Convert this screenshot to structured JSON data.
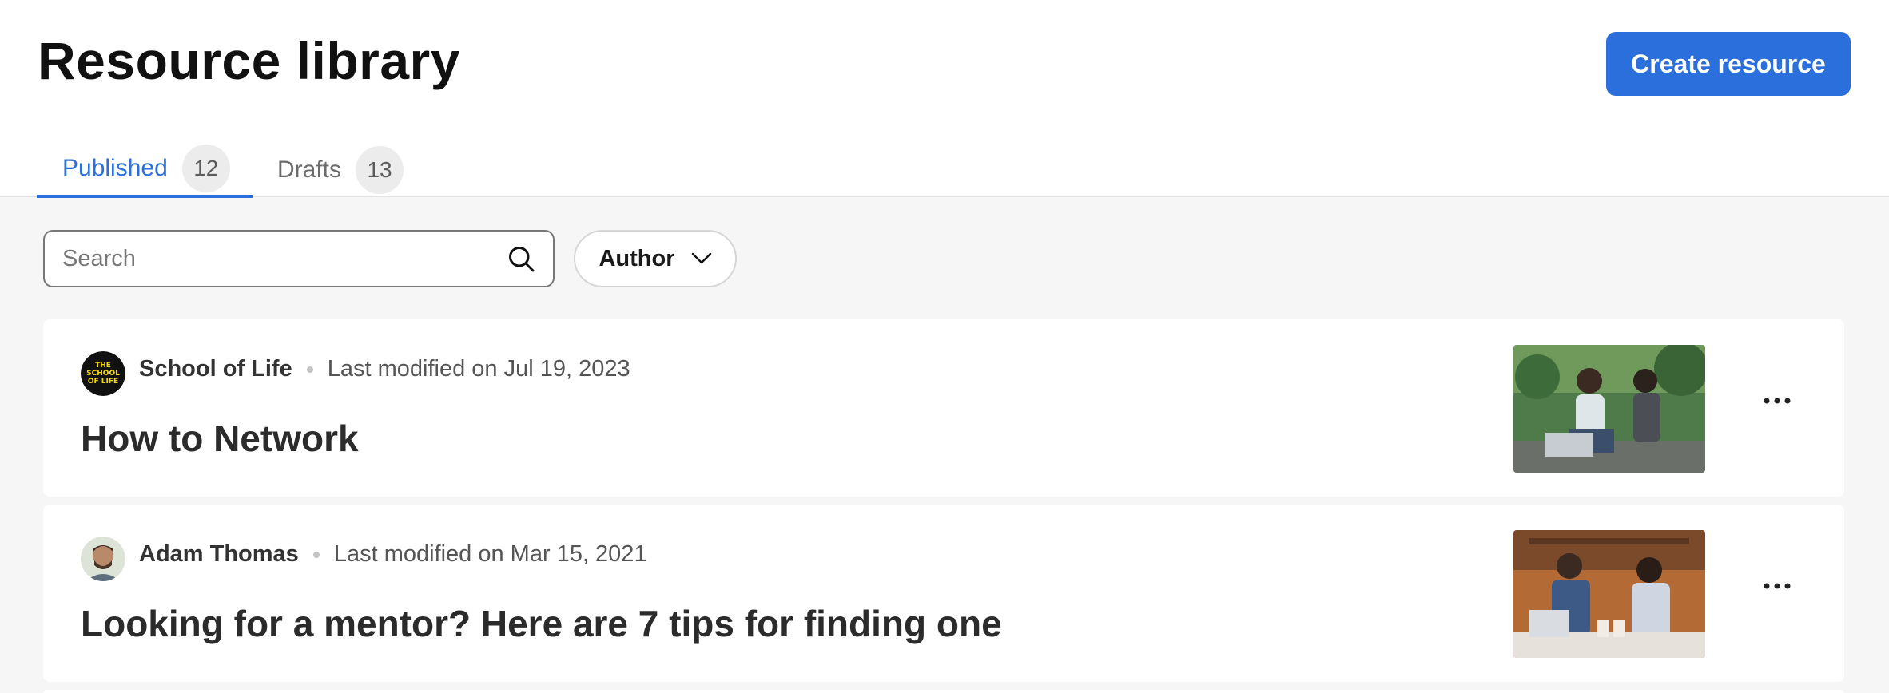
{
  "header": {
    "title": "Resource library",
    "create_button": "Create resource"
  },
  "tabs": [
    {
      "label": "Published",
      "count": "12",
      "active": true
    },
    {
      "label": "Drafts",
      "count": "13",
      "active": false
    }
  ],
  "filters": {
    "search_placeholder": "Search",
    "author_label": "Author"
  },
  "resources": [
    {
      "author": "School of Life",
      "modified": "Last modified on Jul 19, 2023",
      "title": "How to Network",
      "avatar_logo_text": "THE SCHOOL OF LIFE"
    },
    {
      "author": "Adam Thomas",
      "modified": "Last modified on Mar 15, 2021",
      "title": "Looking for a mentor? Here are 7 tips for finding one"
    }
  ],
  "colors": {
    "accent": "#2a6fdb",
    "background": "#f6f6f6"
  }
}
